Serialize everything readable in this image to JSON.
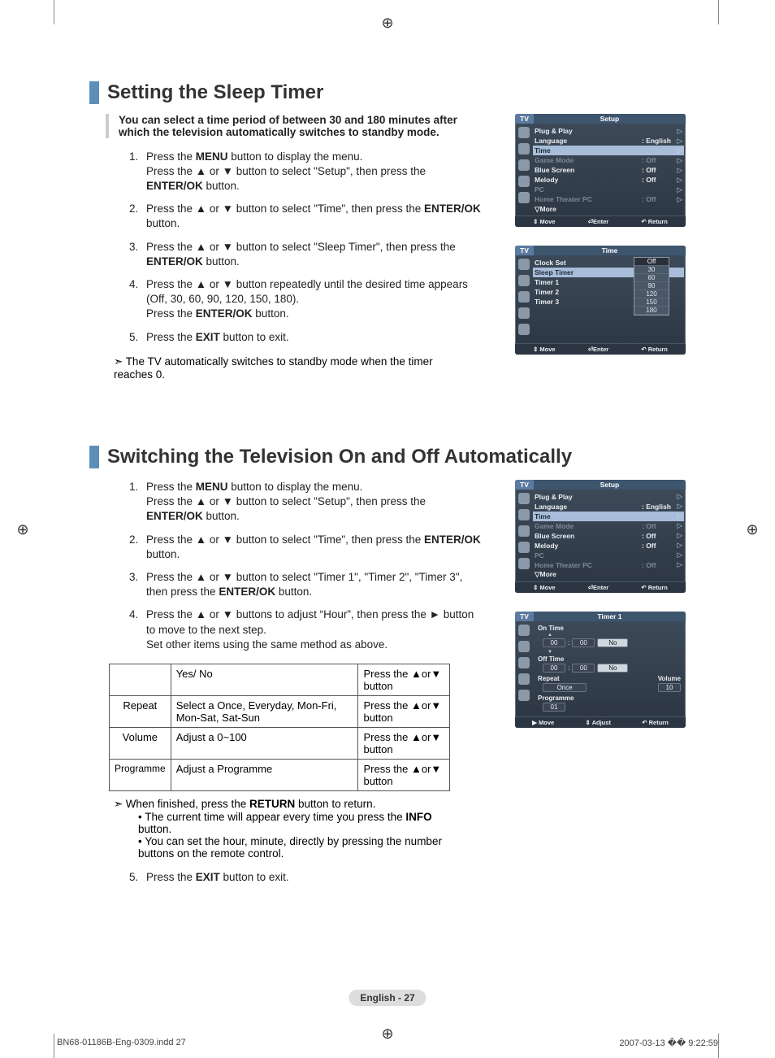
{
  "section1": {
    "title": "Setting the Sleep Timer",
    "lead": "You can select a time period of between 30 and 180 minutes after which the television automatically switches to standby mode.",
    "steps": [
      "Press the <b>MENU</b> button to display the menu.<br>Press the ▲ or ▼ button to select \"Setup\", then press the <b>ENTER/OK</b> button.",
      "Press the ▲ or ▼ button to select \"Time\", then press the <b>ENTER/OK</b> button.",
      "Press the ▲ or ▼ button to select \"Sleep Timer\", then press the <b>ENTER/OK</b> button.",
      "Press the ▲ or ▼ button repeatedly until the desired time appears (Off, 30, 60, 90, 120, 150, 180).<br>Press the <b>ENTER/OK</b> button.",
      "Press the <b>EXIT</b> button to exit."
    ],
    "note": "The TV automatically switches to standby mode when the timer reaches 0."
  },
  "section2": {
    "title": "Switching the Television On and Off Automatically",
    "steps": [
      "Press the <b>MENU</b> button to display the menu.<br>Press the ▲ or ▼ button to select \"Setup\", then press the <b>ENTER/OK</b> button.",
      "Press the ▲ or ▼ button to select \"Time\", then press the <b>ENTER/OK</b> button.",
      "Press the ▲ or ▼ button to select \"Timer 1\", \"Timer 2\", \"Timer 3\", then press the <b>ENTER/OK</b> button.",
      "Press the ▲ or ▼ buttons to adjust “Hour”, then press the ► button to move to the next step.<br>Set other items using the same method as above."
    ],
    "table": {
      "r1": {
        "c1": "",
        "c2": "Yes/ No",
        "c3": "Press the ▲or▼ button"
      },
      "r2": {
        "c1": "Repeat",
        "c2": "Select a Once, Everyday, Mon-Fri, Mon-Sat, Sat-Sun",
        "c3": "Press the ▲or▼ button"
      },
      "r3": {
        "c1": "Volume",
        "c2": "Adjust a 0~100",
        "c3": "Press the ▲or▼ button"
      },
      "r4": {
        "c1": "Programme",
        "c2": "Adjust a Programme",
        "c3": "Press the ▲or▼ button"
      }
    },
    "note": "When finished, press the <b>RETURN</b> button to return.",
    "bullets": [
      "The current time will appear every time you press the <b>INFO</b> button.",
      "You can set the hour, minute, directly by pressing the number buttons on the remote control."
    ],
    "step5": "Press the <b>EXIT</b> button to exit."
  },
  "osd": {
    "setup1": {
      "tv": "TV",
      "title": "Setup",
      "rows": [
        {
          "label": "Plug & Play",
          "val": "",
          "arr": "▷",
          "dim": false
        },
        {
          "label": "Language",
          "val": ": English",
          "arr": "▷",
          "dim": false
        },
        {
          "label": "Time",
          "val": "",
          "arr": "▷",
          "dim": false,
          "hl": true
        },
        {
          "label": "Game Mode",
          "val": ": Off",
          "arr": "▷",
          "dim": true
        },
        {
          "label": "Blue Screen",
          "val": ": Off",
          "arr": "▷",
          "dim": false
        },
        {
          "label": "Melody",
          "val": ": Off",
          "arr": "▷",
          "dim": false
        },
        {
          "label": "PC",
          "val": "",
          "arr": "▷",
          "dim": true
        },
        {
          "label": "Home Theater PC",
          "val": ": Off",
          "arr": "▷",
          "dim": true
        },
        {
          "label": "▽More",
          "val": "",
          "arr": "",
          "dim": false
        }
      ],
      "foot": {
        "a": "⇕ Move",
        "b": "⏎Enter",
        "c": "↶ Return"
      }
    },
    "time1": {
      "tv": "TV",
      "title": "Time",
      "rows": [
        {
          "label": "Clock Set",
          "val": ":"
        },
        {
          "label": "Sleep Timer",
          "val": ":",
          "hl": true
        },
        {
          "label": "Timer 1",
          "val": ":"
        },
        {
          "label": "Timer 2",
          "val": ":"
        },
        {
          "label": "Timer 3",
          "val": ":"
        }
      ],
      "dropdown": [
        "Off",
        "30",
        "60",
        "90",
        "120",
        "150",
        "180"
      ],
      "foot": {
        "a": "⇕ Move",
        "b": "⏎Enter",
        "c": "↶ Return"
      }
    },
    "setup2": {
      "tv": "TV",
      "title": "Setup",
      "rows": [
        {
          "label": "Plug & Play",
          "val": "",
          "arr": "▷"
        },
        {
          "label": "Language",
          "val": ": English",
          "arr": "▷"
        },
        {
          "label": "Time",
          "val": "",
          "arr": "▷",
          "hl": true
        },
        {
          "label": "Game Mode",
          "val": ": Off",
          "arr": "▷",
          "dim": true
        },
        {
          "label": "Blue Screen",
          "val": ": Off",
          "arr": "▷"
        },
        {
          "label": "Melody",
          "val": ": Off",
          "arr": "▷"
        },
        {
          "label": "PC",
          "val": "",
          "arr": "▷",
          "dim": true
        },
        {
          "label": "Home Theater PC",
          "val": ": Off",
          "arr": "▷",
          "dim": true
        },
        {
          "label": "▽More",
          "val": "",
          "arr": ""
        }
      ],
      "foot": {
        "a": "⇕ Move",
        "b": "⏎Enter",
        "c": "↶ Return"
      }
    },
    "timer1": {
      "tv": "TV",
      "title": "Timer 1",
      "onTimeLabel": "On Time",
      "onHour": "00",
      "onMin": "00",
      "onYN": "No",
      "offTimeLabel": "Off Time",
      "offHour": "00",
      "offMin": "00",
      "offYN": "No",
      "repeatLabel": "Repeat",
      "repeatVal": "Once",
      "volumeLabel": "Volume",
      "volumeVal": "10",
      "progLabel": "Programme",
      "progVal": "01",
      "foot": {
        "a": "▶ Move",
        "b": "⇕ Adjust",
        "c": "↶ Return"
      }
    }
  },
  "pagePill": "English - 27",
  "footer": {
    "file": "BN68-01186B-Eng-0309.indd   27",
    "stamp": "2007-03-13   �� 9:22:59"
  }
}
